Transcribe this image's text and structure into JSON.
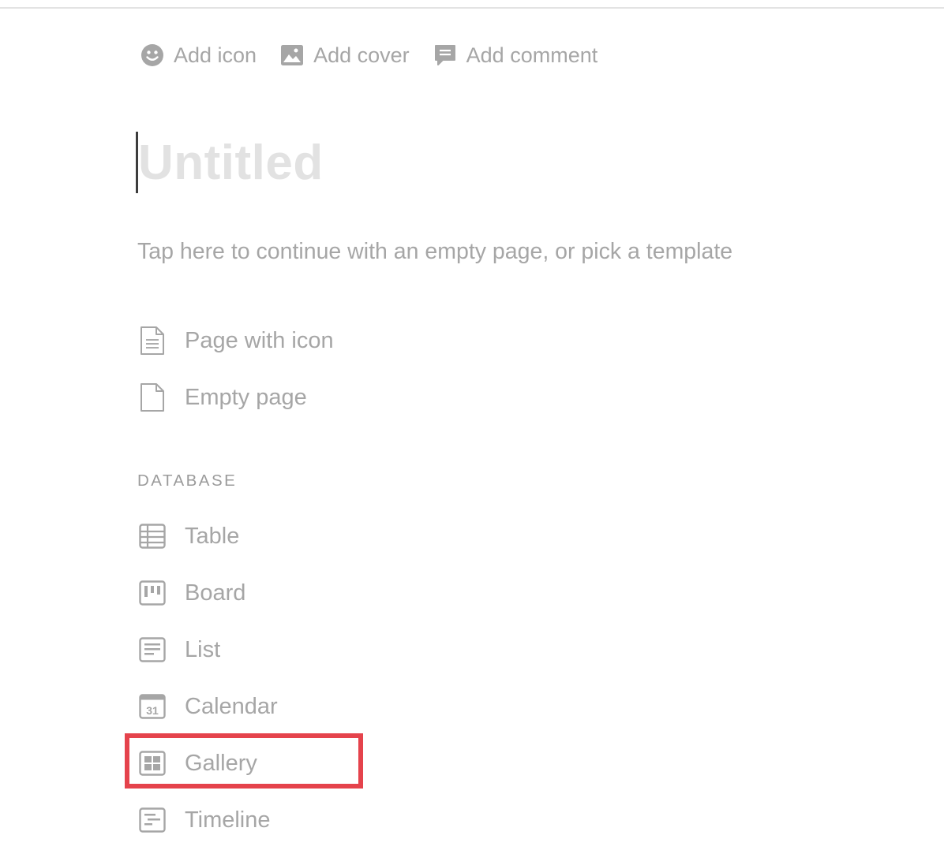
{
  "header": {
    "actions": [
      {
        "label": "Add icon",
        "icon": "smiley-icon"
      },
      {
        "label": "Add cover",
        "icon": "image-icon"
      },
      {
        "label": "Add comment",
        "icon": "comment-icon"
      }
    ]
  },
  "page": {
    "title_placeholder": "Untitled",
    "hint": "Tap here to continue with an empty page, or pick a template"
  },
  "templates": [
    {
      "label": "Page with icon",
      "icon": "document-lines-icon"
    },
    {
      "label": "Empty page",
      "icon": "document-blank-icon"
    }
  ],
  "database": {
    "section_label": "DATABASE",
    "items": [
      {
        "label": "Table",
        "icon": "table-icon"
      },
      {
        "label": "Board",
        "icon": "board-icon"
      },
      {
        "label": "List",
        "icon": "list-icon"
      },
      {
        "label": "Calendar",
        "icon": "calendar-icon",
        "icon_text": "31"
      },
      {
        "label": "Gallery",
        "icon": "gallery-icon",
        "highlighted": true
      },
      {
        "label": "Timeline",
        "icon": "timeline-icon"
      }
    ]
  },
  "colors": {
    "text_muted": "#a6a6a6",
    "title_placeholder": "#e2e2e2",
    "highlight": "#e5434c"
  }
}
